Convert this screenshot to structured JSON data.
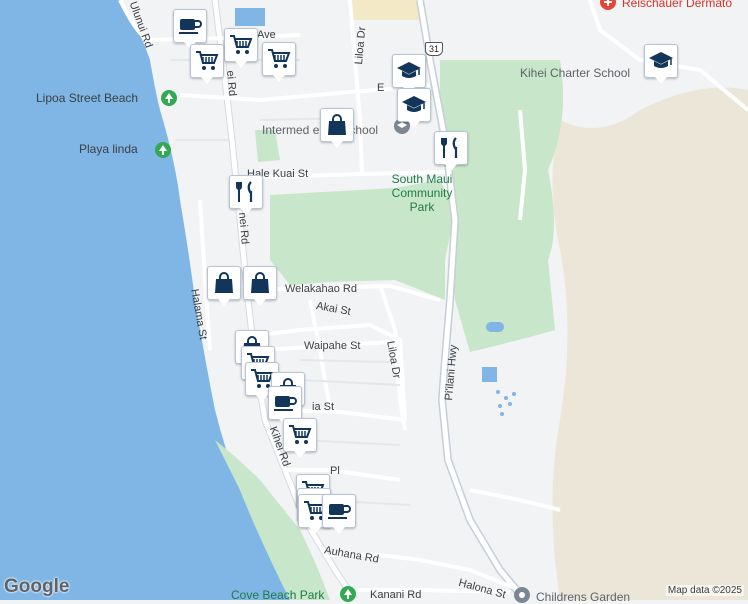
{
  "map": {
    "colors": {
      "water": "#7fb6e6",
      "land": "#f1f3f4",
      "park": "#c8e6c9",
      "road": "#ffffff",
      "highway": "#c6ced8",
      "marker_icon": "#12355b"
    },
    "labels": {
      "ulunui_rd": "Ulunui Rd",
      "ave": "Ave",
      "liloa_dr_top": "Liloa Dr",
      "e_top": "E",
      "ei_rd": "ei Rd",
      "lipoa_street_beach": "Lipoa Street Beach",
      "playa_linda": "Playa linda",
      "intermediate_school": "Intermed  elani School",
      "hale_kuai_st": "Hale Kuai St",
      "south_maui_community_park": "South Maui Community Park",
      "kihei_charter_school": "Kihei Charter School",
      "kaonoulu_rd": "nei Rd",
      "welakahao_rd": "Welakahao Rd",
      "akai_st": "Akai St",
      "waipahe_st": "Waipahe St",
      "liloa_dr": "Liloa Dr",
      "piilani_hwy": "Pi'ilani Hwy",
      "kalana_st": "Halama St",
      "ia_st": "ia St",
      "kihei_rd": "Kihei Rd",
      "pl": "Pl",
      "auhana_rd": "Auhana Rd",
      "cove_beach_park": "Cove Beach Park",
      "kanani_rd": "Kanani Rd",
      "halona_st": "Halona St",
      "childrens_garden": "Childrens Garden",
      "reischauer": "Reischauer Dermato",
      "route_31": "31"
    },
    "markers": [
      {
        "type": "cafe"
      },
      {
        "type": "cart"
      },
      {
        "type": "cart"
      },
      {
        "type": "cart"
      },
      {
        "type": "school"
      },
      {
        "type": "school"
      },
      {
        "type": "bag"
      },
      {
        "type": "restaurant"
      },
      {
        "type": "school"
      },
      {
        "type": "restaurant"
      },
      {
        "type": "bag"
      },
      {
        "type": "bag"
      },
      {
        "type": "bag"
      },
      {
        "type": "cart"
      },
      {
        "type": "cart"
      },
      {
        "type": "cart"
      },
      {
        "type": "cafe"
      },
      {
        "type": "cafe"
      },
      {
        "type": "cart"
      },
      {
        "type": "cart"
      },
      {
        "type": "cart"
      },
      {
        "type": "cafe"
      }
    ],
    "google_logo": "Google",
    "attribution": "Map data ©2025"
  }
}
